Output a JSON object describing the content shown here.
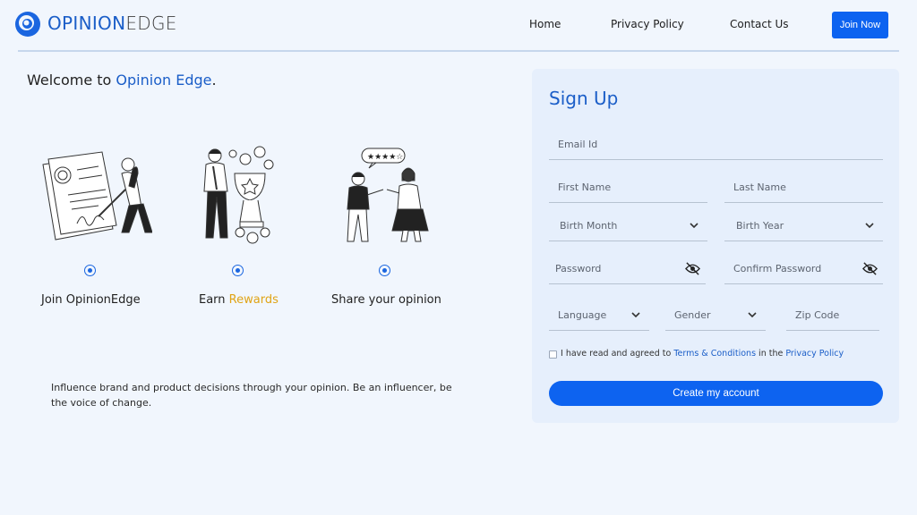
{
  "header": {
    "logo_part1": "OPINION",
    "logo_part2": "EDGE",
    "nav": {
      "home": "Home",
      "privacy": "Privacy Policy",
      "contact": "Contact Us"
    },
    "join_button": "Join Now"
  },
  "welcome": {
    "prefix": "Welcome to ",
    "brand": "Opinion Edge",
    "suffix": "."
  },
  "features": [
    {
      "label": "Join OpinionEdge"
    },
    {
      "label_prefix": "Earn ",
      "label_highlight": "Rewards"
    },
    {
      "label": "Share your opinion"
    }
  ],
  "tagline": "Influence brand and product decisions through your opinion. Be an influencer, be the voice of change.",
  "signup": {
    "title": "Sign Up",
    "email": "Email Id",
    "first_name": "First Name",
    "last_name": "Last Name",
    "birth_month": "Birth Month",
    "birth_year": "Birth Year",
    "password": "Password",
    "confirm_password": "Confirm Password",
    "language": "Language",
    "gender": "Gender",
    "zip": "Zip Code",
    "agree_prefix": "I have read and agreed to ",
    "terms": "Terms & Conditions",
    "agree_middle": " in the ",
    "privacy": "Privacy Policy",
    "create_button": "Create my account"
  },
  "colors": {
    "accent": "#0d63f0",
    "brand_text": "#1b5ec8",
    "gold": "#e0a416",
    "card_bg": "#e6effc",
    "page_bg": "#f1f6fd"
  },
  "icons": [
    "logo-mark-icon",
    "chevron-down-icon",
    "eye-slash-icon",
    "radio-dot-icon"
  ]
}
